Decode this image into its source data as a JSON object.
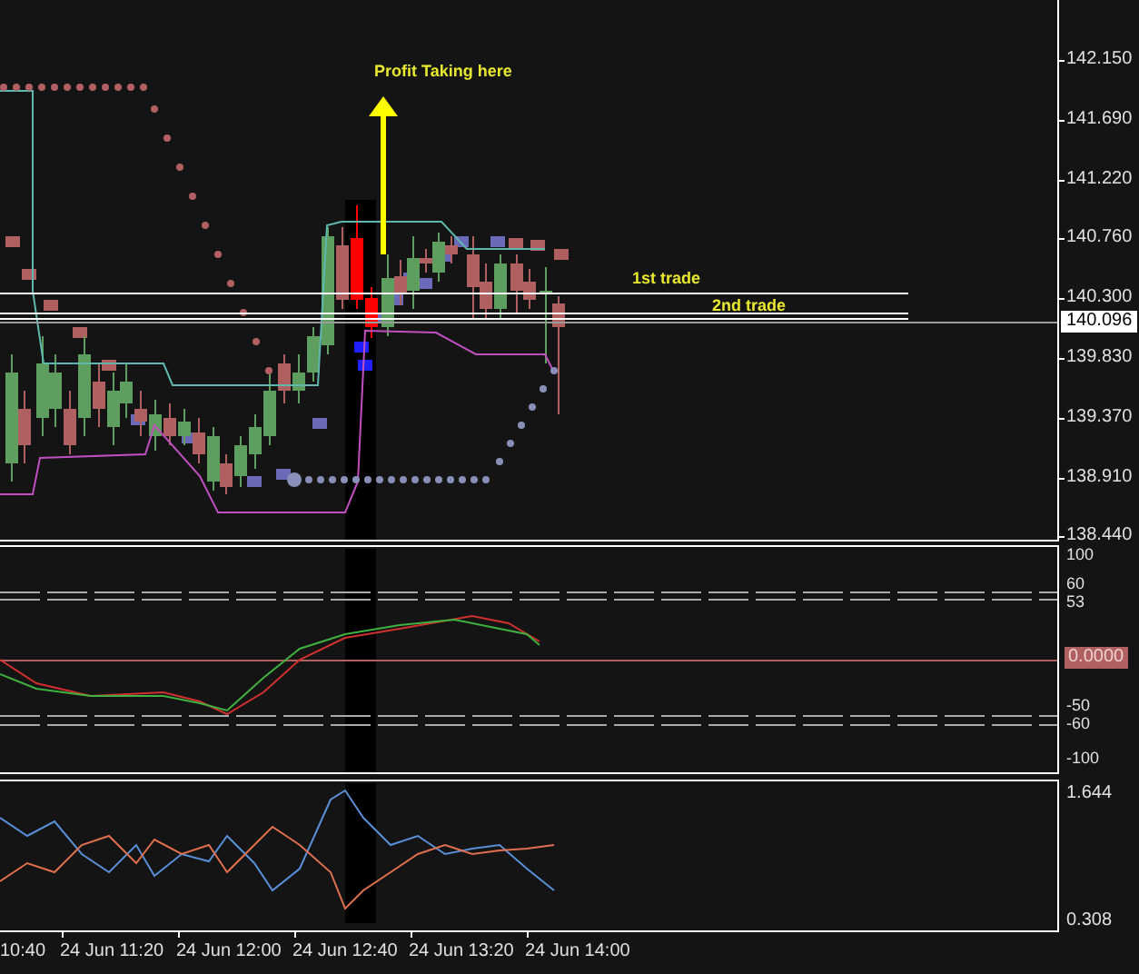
{
  "price_pane": {
    "annotations": [
      {
        "kind": "arrow-label",
        "text": "Profit Taking here"
      },
      {
        "kind": "line-label",
        "text": "1st trade"
      },
      {
        "kind": "line-label",
        "text": "2nd trade"
      }
    ],
    "axis_labels": [
      "142.150",
      "141.690",
      "141.220",
      "140.760",
      "140.300",
      "139.830",
      "139.370",
      "138.910",
      "138.440"
    ],
    "current_price": "140.096"
  },
  "oscillator_pane": {
    "axis_labels": [
      "100",
      "60",
      "53",
      "-50",
      "-60",
      "-100"
    ],
    "zero_label": "0.0000"
  },
  "lower_pane": {
    "axis_labels": [
      "1.644",
      "0.308"
    ]
  },
  "time_axis": {
    "labels": [
      "10:40",
      "24 Jun 11:20",
      "24 Jun 12:00",
      "24 Jun 12:40",
      "24 Jun 13:20",
      "24 Jun 14:00"
    ]
  }
}
